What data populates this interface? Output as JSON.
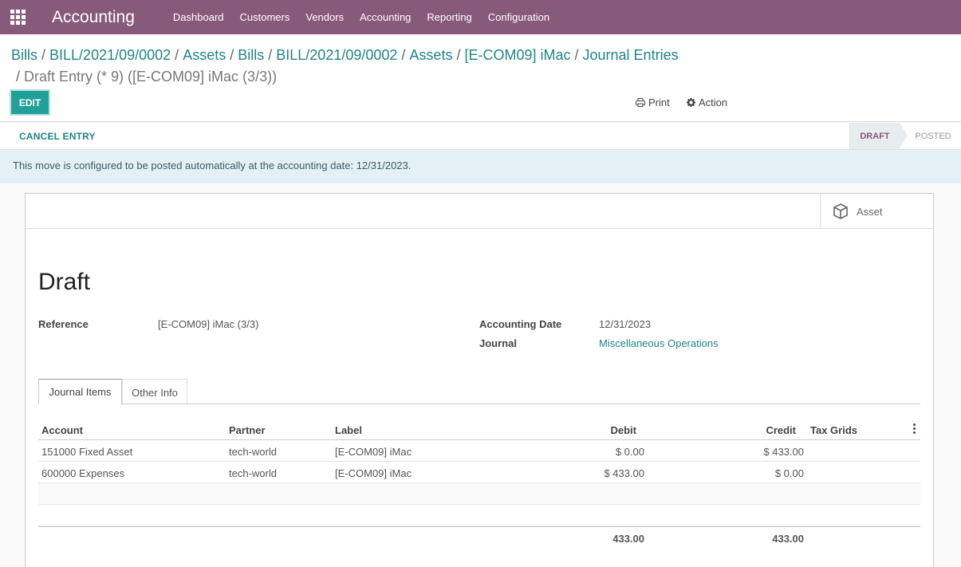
{
  "nav": {
    "app_title": "Accounting",
    "menu": [
      "Dashboard",
      "Customers",
      "Vendors",
      "Accounting",
      "Reporting",
      "Configuration"
    ]
  },
  "breadcrumb": {
    "items": [
      "Bills",
      "BILL/2021/09/0002",
      "Assets",
      "Bills",
      "BILL/2021/09/0002",
      "Assets",
      "[E-COM09] iMac",
      "Journal Entries"
    ],
    "current": "Draft Entry (* 9) ([E-COM09] iMac (3/3))"
  },
  "toolbar": {
    "edit_label": "EDIT",
    "print_label": "Print",
    "action_label": "Action"
  },
  "statusbar": {
    "cancel_label": "CANCEL ENTRY",
    "stages": [
      "DRAFT",
      "POSTED"
    ]
  },
  "alert": {
    "text": "This move is configured to be posted automatically at the accounting date: 12/31/2023."
  },
  "smart_button": {
    "label": "Asset"
  },
  "form": {
    "title": "Draft",
    "reference_label": "Reference",
    "reference_value": "[E-COM09] iMac (3/3)",
    "accounting_date_label": "Accounting Date",
    "accounting_date_value": "12/31/2023",
    "journal_label": "Journal",
    "journal_value": "Miscellaneous Operations"
  },
  "tabs": [
    "Journal Items",
    "Other Info"
  ],
  "table": {
    "headers": {
      "account": "Account",
      "partner": "Partner",
      "label": "Label",
      "debit": "Debit",
      "credit": "Credit",
      "tax_grids": "Tax Grids"
    },
    "rows": [
      {
        "account": "151000 Fixed Asset",
        "partner": "tech-world",
        "label": "[E-COM09] iMac",
        "debit": "$ 0.00",
        "credit": "$ 433.00"
      },
      {
        "account": "600000 Expenses",
        "partner": "tech-world",
        "label": "[E-COM09] iMac",
        "debit": "$ 433.00",
        "credit": "$ 0.00"
      }
    ],
    "totals": {
      "debit": "433.00",
      "credit": "433.00"
    }
  }
}
